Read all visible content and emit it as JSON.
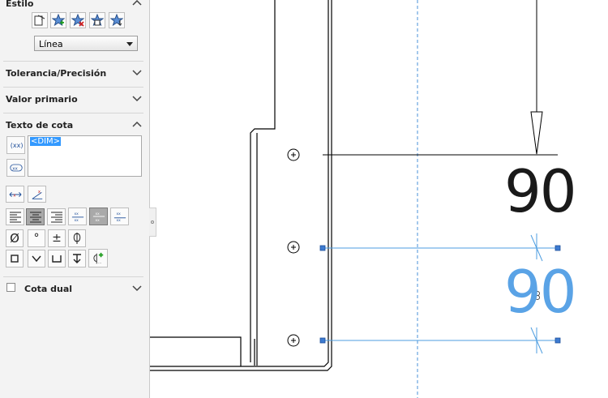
{
  "panel": {
    "estilo": {
      "title": "Estilo"
    },
    "combo": {
      "value": "Línea"
    },
    "tolerancia": {
      "title": "Tolerancia/Precisión"
    },
    "valor_primario": {
      "title": "Valor primario"
    },
    "texto_cota": {
      "title": "Texto de cota",
      "text_value": "<DIM>",
      "symbols": {
        "phi": "Ø",
        "degree": "°",
        "plus_minus": "±"
      }
    },
    "cota_dual": {
      "title": "Cota dual",
      "checked": false
    }
  },
  "drawing": {
    "dimension_black": "90",
    "dimension_blue": "90",
    "colors": {
      "line": "#000000",
      "selected": "#4d9de0",
      "handle": "#3d7bd1",
      "centerline": "#4a90d9"
    }
  }
}
